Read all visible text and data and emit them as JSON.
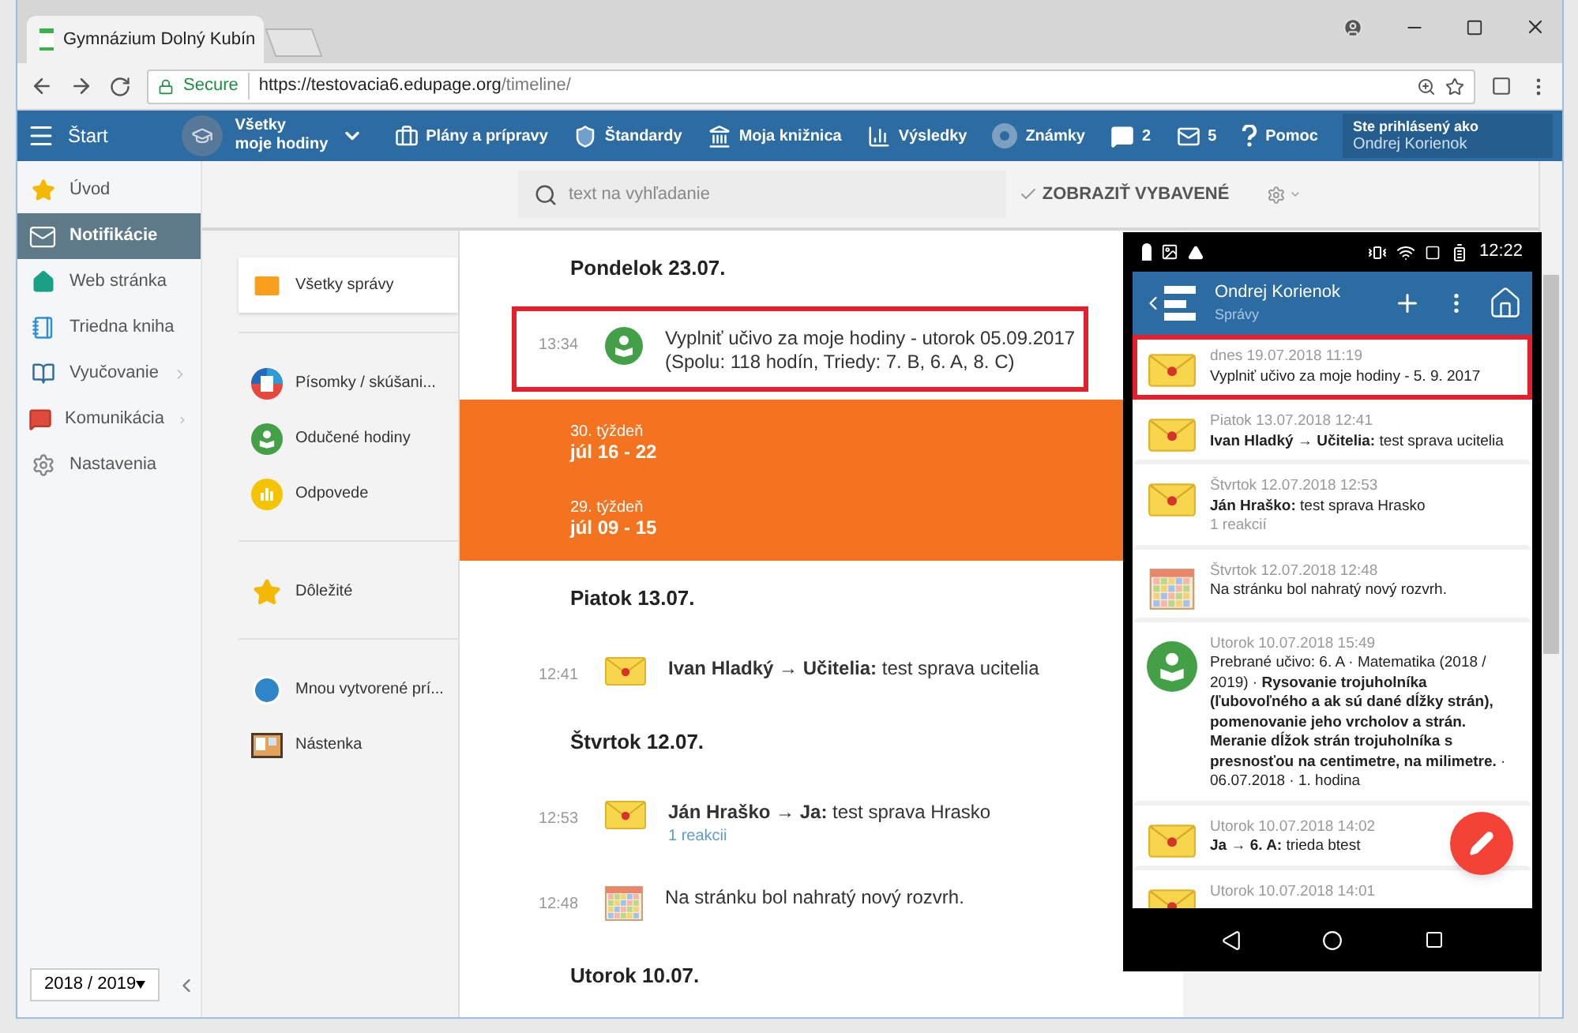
{
  "browser": {
    "tab_title": "Gymnázium Dolný Kubín",
    "secure_label": "Secure",
    "url_host": "https://testovacia6.edupage.org",
    "url_path": "/timeline/"
  },
  "nav": {
    "start": "Štart",
    "class_line1": "Všetky",
    "class_line2": "moje hodiny",
    "items": [
      {
        "kind": "plans",
        "label": "Plány a prípravy"
      },
      {
        "kind": "standards",
        "label": "Štandardy"
      },
      {
        "kind": "library",
        "label": "Moja knižnica"
      },
      {
        "kind": "results",
        "label": "Výsledky"
      },
      {
        "kind": "grades",
        "label": "Známky"
      },
      {
        "kind": "chat",
        "label": "2"
      },
      {
        "kind": "mail",
        "label": "5"
      },
      {
        "kind": "help",
        "label": "Pomoc"
      }
    ],
    "user_label": "Ste prihlásený ako",
    "user_name": "Ondrej Korienok"
  },
  "sidebar": {
    "items": [
      {
        "kind": "star",
        "label": "Úvod",
        "selected": false,
        "expandable": false
      },
      {
        "kind": "mail",
        "label": "Notifikácie",
        "selected": true,
        "expandable": false
      },
      {
        "kind": "home",
        "label": "Web stránka",
        "selected": false,
        "expandable": false
      },
      {
        "kind": "notebook",
        "label": "Triedna kniha",
        "selected": false,
        "expandable": false
      },
      {
        "kind": "book",
        "label": "Vyučovanie",
        "selected": false,
        "expandable": true
      },
      {
        "kind": "chat",
        "label": "Komunikácia",
        "selected": false,
        "expandable": true
      },
      {
        "kind": "gear",
        "label": "Nastavenia",
        "selected": false,
        "expandable": false
      }
    ],
    "year": "2018 / 2019"
  },
  "search": {
    "placeholder": "text na vyhľadanie",
    "show_done": "ZOBRAZIŤ VYBAVENÉ"
  },
  "filter_groups": [
    {
      "items": [
        {
          "kind": "mail",
          "label": "Všetky správy",
          "selected": true
        }
      ]
    },
    {
      "items": [
        {
          "kind": "test",
          "label": "Písomky / skúšani...",
          "selected": false
        },
        {
          "kind": "lesson",
          "label": "Odučené hodiny",
          "selected": false
        },
        {
          "kind": "answers",
          "label": "Odpovede",
          "selected": false
        }
      ]
    },
    {
      "items": [
        {
          "kind": "star",
          "label": "Dôležité",
          "selected": false
        }
      ]
    },
    {
      "items": [
        {
          "kind": "created",
          "label": "Mnou vytvorené prí...",
          "selected": false
        },
        {
          "kind": "board",
          "label": "Nástenka",
          "selected": false
        }
      ]
    }
  ],
  "timeline": [
    {
      "kind": "day",
      "label": "Pondelok 23.07."
    },
    {
      "kind": "lesson",
      "time": "13:34",
      "text": "Vyplniť učivo za moje hodiny - utorok 05.09.2017",
      "subtext": "(Spolu: 118 hodín, Triedy: 7. B, 6. A, 8. C)",
      "highlighted": true
    },
    {
      "kind": "weeks",
      "weeks": [
        {
          "number": "30. týždeň",
          "range": "júl 16 - 22"
        },
        {
          "number": "29. týždeň",
          "range": "júl 09 - 15"
        }
      ]
    },
    {
      "kind": "day",
      "label": "Piatok 13.07."
    },
    {
      "kind": "message",
      "time": "12:41",
      "text": "**Ivan Hladký → Učitelia:** test sprava ucitelia",
      "highlighted": false
    },
    {
      "kind": "day",
      "label": "Štvrtok 12.07."
    },
    {
      "kind": "message",
      "time": "12:53",
      "text": "**Ján Hraško → Ja:** test sprava Hrasko",
      "reactions": "1 reakcii",
      "highlighted": false
    },
    {
      "kind": "schedule",
      "time": "12:48",
      "text": "Na stránku bol nahratý nový rozvrh.",
      "highlighted": false
    },
    {
      "kind": "day",
      "label": "Utorok 10.07."
    }
  ],
  "phone": {
    "time": "12:22",
    "name": "Ondrej Korienok",
    "subtitle": "Správy",
    "items": [
      {
        "kind": "message",
        "date": "dnes 19.07.2018 11:19",
        "text": "Vyplniť učivo za moje hodiny - 5. 9. 2017",
        "highlighted": true
      },
      {
        "kind": "message",
        "date": "Piatok 13.07.2018 12:41",
        "text": "**Ivan Hladký**  → **Učitelia:** test sprava ucitelia",
        "highlighted": false
      },
      {
        "kind": "message",
        "date": "Štvrtok 12.07.2018 12:53",
        "text": "**Ján Hraško:** test sprava Hrasko",
        "extra": "1 reakcií",
        "highlighted": false
      },
      {
        "kind": "schedule",
        "date": "Štvrtok 12.07.2018 12:48",
        "text": "Na stránku bol nahratý nový rozvrh.",
        "highlighted": false
      },
      {
        "kind": "lesson",
        "date": "Utorok 10.07.2018 15:49",
        "text": "Prebrané učivo: 6. A · Matematika (2018 / 2019) · **Rysovanie trojuholníka (ľubovoľného a ak sú dané dĺžky strán), pomenovanie jeho vrcholov a strán. Meranie dĺžok strán trojuholníka s presnosťou na centimetre, na milimetre.** · 06.07.2018 · 1. hodina",
        "highlighted": false
      },
      {
        "kind": "message",
        "date": "Utorok 10.07.2018 14:02",
        "text": "**Ja** → **6. A:** trieda btest",
        "highlighted": false
      },
      {
        "kind": "message",
        "date": "Utorok 10.07.2018 14:01",
        "highlighted": false
      }
    ]
  }
}
